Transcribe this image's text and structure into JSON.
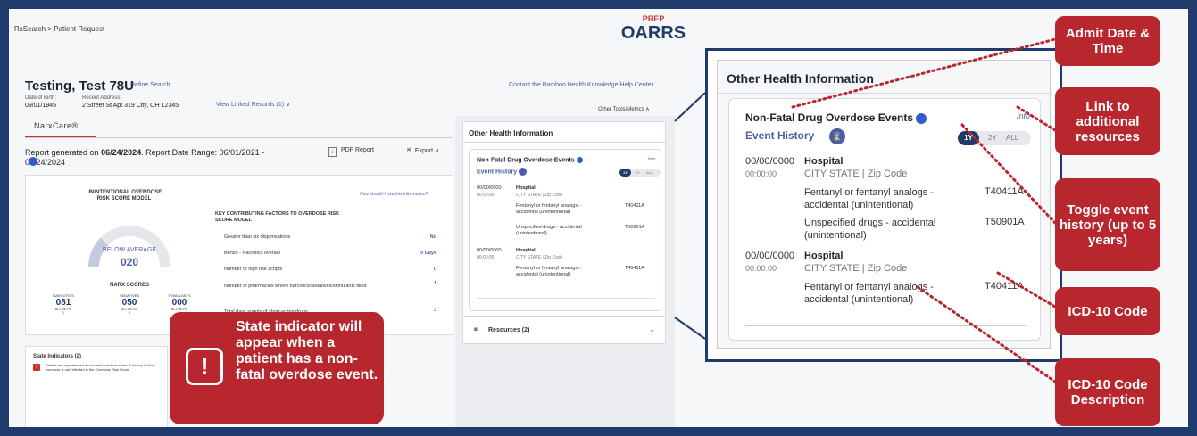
{
  "breadcrumb": "RxSearch > Patient Request",
  "logo": {
    "prep": "PREP",
    "name": "OARRS"
  },
  "patient": {
    "name": "Testing, Test 78U",
    "refine": "Refine Search",
    "dob_label": "Date of Birth:",
    "dob": "09/01/1945",
    "address_label": "Recent Address:",
    "address": "2 Street St Apt 319 City, OH 12345",
    "linked": "View Linked Records (1) ∨"
  },
  "header": {
    "help_link": "Contact the Bamboo Health Knowledge/Help Center",
    "tools": "Other Tools/Metrics ∧"
  },
  "narxcare": {
    "tab": "NarxCare®",
    "report_prefix": "Report generated on ",
    "report_date": "06/24/2024",
    "report_suffix": ". Report Date Range: 06/01/2021 - 06/24/2024",
    "pdf": "PDF Report",
    "export": "Export ∨"
  },
  "risk": {
    "title": "UNINTENTIONAL OVERDOSE RISK SCORE MODEL",
    "how": "How should I use this information?",
    "level": "BELOW AVERAGE",
    "score": "020",
    "narx_title": "NARX SCORES",
    "narx": [
      {
        "label": "NARCOTICS",
        "value": "081",
        "active_label": "ACTIVE RX",
        "active": "1"
      },
      {
        "label": "SEDATIVES",
        "value": "050",
        "active_label": "ACTIVE RX",
        "active": "0"
      },
      {
        "label": "STIMULANTS",
        "value": "000",
        "active_label": "ACTIVE RX",
        "active": "0"
      }
    ],
    "factors_title": "KEY CONTRIBUTING FACTORS TO OVERDOSE RISK SCORE MODEL",
    "factors": [
      {
        "label": "Greater than six dispensations",
        "value": "No"
      },
      {
        "label": "Benzo - Narcotics overlap",
        "value": "0 Days"
      },
      {
        "label": "Number of high risk scripts",
        "value": "0"
      },
      {
        "label": "Number of pharmacies where narcotics/sedatives/stimulants filled",
        "value": "1"
      },
      {
        "label": "Total days supply of short-acting drugs",
        "value": "3"
      }
    ]
  },
  "state": {
    "title": "State Indicators (2)",
    "text": "Patient has experienced a non-fatal overdose event. A history of drug overdose is not reflected in the Overdose Risk Score.",
    "callout": "State indicator will appear when a patient has a non-fatal overdose event."
  },
  "ohi": {
    "title": "Other Health Information",
    "nf_title": "Non-Fatal Drug Overdose Events",
    "info": "Info",
    "event_history": "Event History",
    "toggle": [
      "1Y",
      "2Y",
      "ALL"
    ],
    "events": [
      {
        "date": "00/00/0000",
        "type": "Hospital",
        "time": "00:00:00",
        "loc": "CITY STATE  | Zip Code",
        "items": [
          {
            "desc": "Fentanyl or fentanyl analogs - accidental (unintentional)",
            "code": "T40411A"
          },
          {
            "desc": "Unspecified drugs - accidental (unintentional)",
            "code": "T50901A"
          }
        ]
      },
      {
        "date": "00/00/0000",
        "type": "Hospital",
        "time": "00:00:00",
        "loc": "CITY STATE  | Zip Code",
        "items": [
          {
            "desc": "Fentanyl or fentanyl analogs - accidental (unintentional)",
            "code": "T40411A"
          }
        ]
      }
    ],
    "resources": "Resources (2)"
  },
  "callouts": {
    "admit": "Admit Date & Time",
    "link": "Link to additional resources",
    "toggle": "Toggle event history (up to 5 years)",
    "icd_code": "ICD-10 Code",
    "icd_desc": "ICD-10 Code Description"
  },
  "colors": {
    "brand_navy": "#1e3b6b",
    "callout_red": "#b8262e",
    "link_blue": "#4b5ea8"
  }
}
